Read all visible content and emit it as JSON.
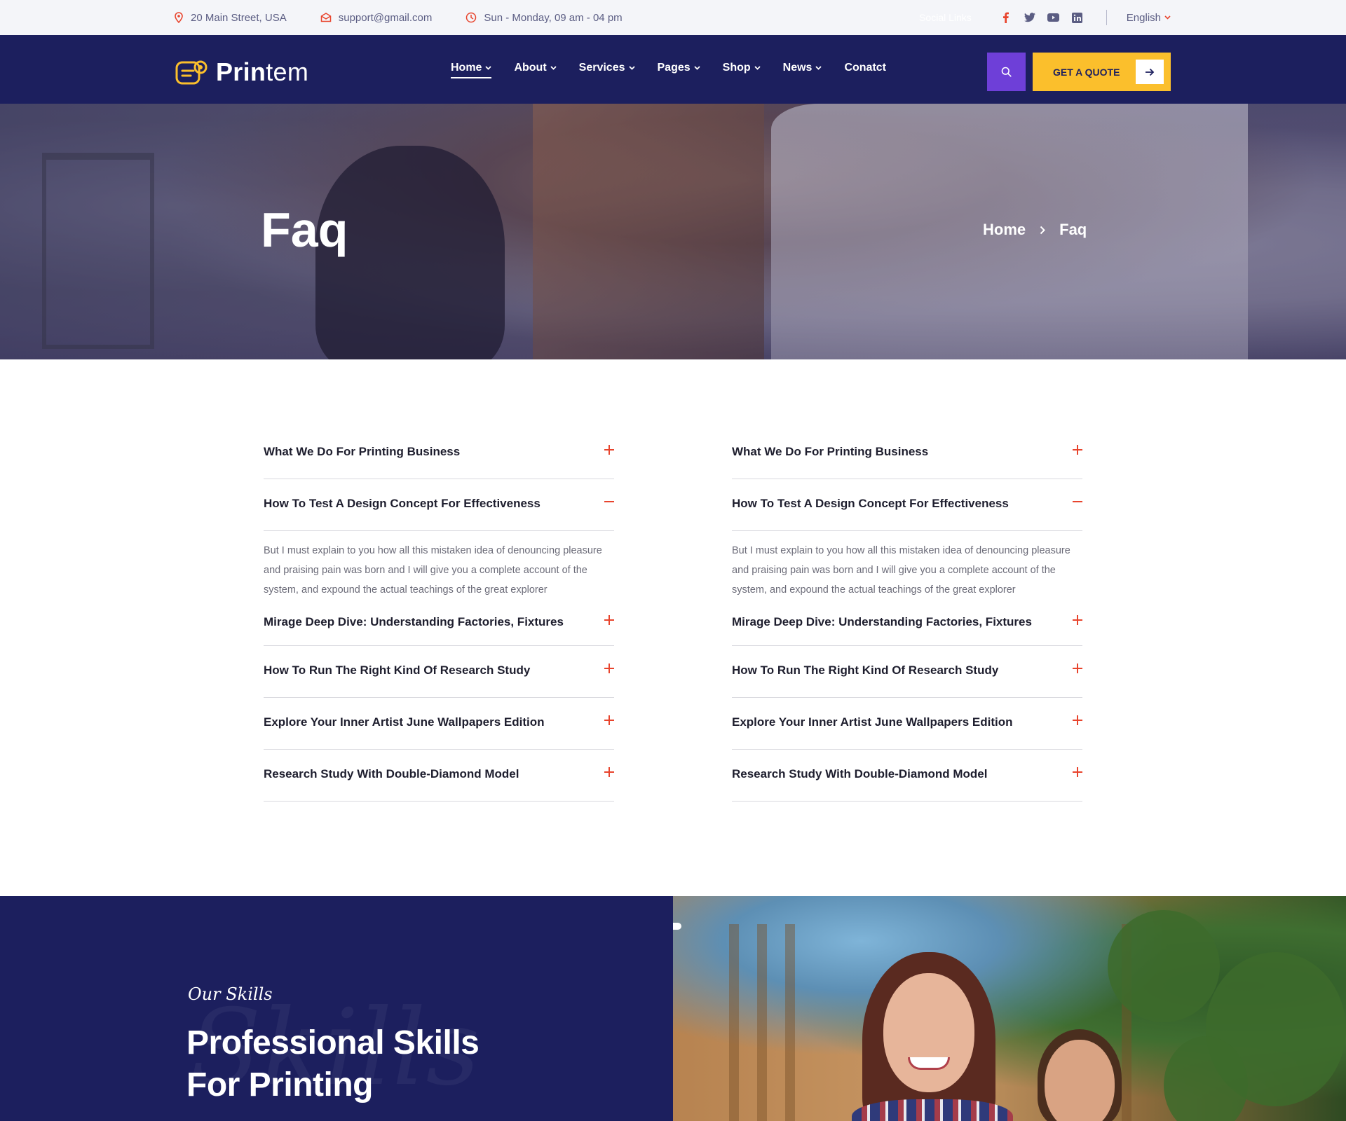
{
  "topbar": {
    "address": "20 Main Street, USA",
    "email": "support@gmail.com",
    "hours": "Sun - Monday, 09 am - 04 pm",
    "social_label": "Social Links",
    "social_icons": [
      "facebook-icon",
      "twitter-icon",
      "youtube-icon",
      "linkedin-icon"
    ],
    "language": "English"
  },
  "nav": {
    "logo_bold": "Prin",
    "logo_light": "tem",
    "items": [
      {
        "label": "Home",
        "dropdown": true,
        "active": true
      },
      {
        "label": "About",
        "dropdown": true
      },
      {
        "label": "Services",
        "dropdown": true
      },
      {
        "label": "Pages",
        "dropdown": true
      },
      {
        "label": "Shop",
        "dropdown": true
      },
      {
        "label": "News",
        "dropdown": true
      },
      {
        "label": "Conatct",
        "dropdown": false
      }
    ],
    "quote_label": "GET A QUOTE"
  },
  "hero": {
    "title": "Faq",
    "breadcrumb_home": "Home",
    "breadcrumb_current": "Faq"
  },
  "faq_left": {
    "q1": "What We Do For Printing Business",
    "q2": "How To Test A Design Concept For Effectiveness",
    "answer": "But I must explain to you how all this mistaken idea of denouncing pleasure and praising pain was born and I will give you a complete account of the system, and expound the actual teachings of the great explorer",
    "q3": "Mirage Deep Dive: Understanding Factories, Fixtures",
    "q4": "How To Run The Right Kind Of Research Study",
    "q5": "Explore Your Inner Artist June Wallpapers Edition",
    "q6": "Research Study With Double-Diamond Model"
  },
  "faq_right": {
    "q1": "What We Do For Printing Business",
    "q2": "How To Test A Design Concept For Effectiveness",
    "answer": "But I must explain to you how all this mistaken idea of denouncing pleasure and praising pain was born and I will give you a complete account of the system, and expound the actual teachings of the great explorer",
    "q3": "Mirage Deep Dive: Understanding Factories, Fixtures",
    "q4": "How To Run The Right Kind Of Research Study",
    "q5": "Explore Your Inner Artist June Wallpapers Edition",
    "q6": "Research Study With Double-Diamond Model"
  },
  "skills": {
    "subtitle": "Our Skills",
    "watermark": "Skills",
    "title_line1": "Professional Skills",
    "title_line2": "For Printing"
  },
  "colors": {
    "navy": "#1c1f5e",
    "accent_yellow": "#fbbf2c",
    "accent_purple": "#6e3fd8",
    "accent_red": "#e8442d"
  }
}
